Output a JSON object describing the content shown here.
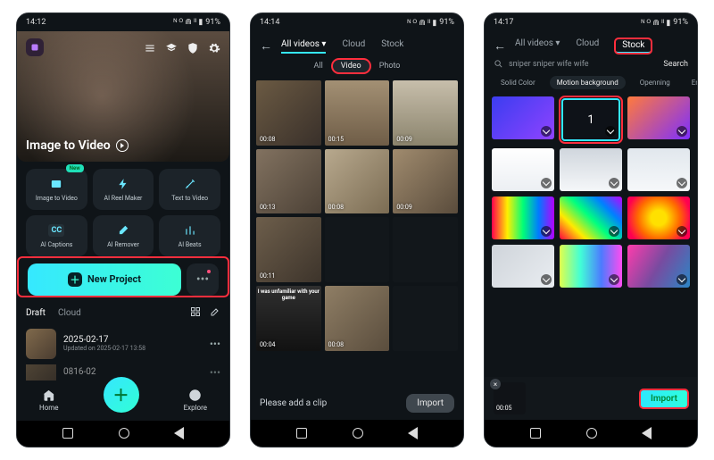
{
  "phone1": {
    "status": {
      "time": "14:12",
      "battery": "91%"
    },
    "hero_title": "Image to Video",
    "tiles": [
      {
        "label": "Image to Video",
        "icon": "film-icon",
        "new": true
      },
      {
        "label": "AI Reel Maker",
        "icon": "bolt-icon"
      },
      {
        "label": "Text to Video",
        "icon": "wand-icon"
      },
      {
        "label": "AI Captions",
        "icon": "cc-icon"
      },
      {
        "label": "AI Remover",
        "icon": "eraser-icon"
      },
      {
        "label": "AI Beats",
        "icon": "equalizer-icon"
      }
    ],
    "new_project": "New Project",
    "draft_tabs": {
      "draft": "Draft",
      "cloud": "Cloud"
    },
    "projects": [
      {
        "name": "2025-02-17",
        "sub": "Updated on 2025-02-17 13:58"
      },
      {
        "name": "0816-02",
        "sub": ""
      }
    ],
    "bottom_nav": {
      "home": "Home",
      "explore": "Explore"
    }
  },
  "phone2": {
    "status": {
      "time": "14:14",
      "battery": "91%"
    },
    "top_tabs": {
      "all_videos": "All videos",
      "cloud": "Cloud",
      "stock": "Stock"
    },
    "sub_tabs": {
      "all": "All",
      "video": "Video",
      "photo": "Photo"
    },
    "clips": [
      {
        "dur": "00:08",
        "bg": "linear-gradient(135deg,#6b5a43,#39302a)"
      },
      {
        "dur": "00:15",
        "bg": "linear-gradient(180deg,#a39074,#6f5d47)"
      },
      {
        "dur": "00:09",
        "bg": "linear-gradient(180deg,#c7beab,#8b846d)"
      },
      {
        "dur": "00:13",
        "bg": "linear-gradient(135deg,#827260,#4c4136)"
      },
      {
        "dur": "00:08",
        "bg": "linear-gradient(135deg,#b8a98e,#7b6c53)"
      },
      {
        "dur": "00:09",
        "bg": "linear-gradient(135deg,#a08b6e,#5a4c3c)"
      },
      {
        "dur": "00:11",
        "bg": "linear-gradient(135deg,#6d5e4b,#3d342b)"
      },
      {
        "dur": "",
        "bg": "#12171b"
      },
      {
        "dur": "",
        "bg": "#12171b"
      },
      {
        "dur": "00:04",
        "bg": "linear-gradient(180deg,#2f2f2f,#121212)",
        "meme": "I was unfamiliar with your game"
      },
      {
        "dur": "00:08",
        "bg": "linear-gradient(135deg,#8f7e65,#5a4d3d)"
      },
      {
        "dur": "",
        "bg": "#12171b"
      }
    ],
    "hint": "Please add a clip",
    "import": "Import"
  },
  "phone3": {
    "status": {
      "time": "14:17",
      "battery": "91%"
    },
    "top_tabs": {
      "all_videos": "All videos",
      "cloud": "Cloud",
      "stock": "Stock"
    },
    "search": {
      "query": "sniper sniper wife wife",
      "button": "Search"
    },
    "chips": [
      "Solid Color",
      "Motion background",
      "Openning",
      "Ending"
    ],
    "stocks": [
      {
        "bg": "linear-gradient(135deg,#3b3df0,#8f43ff)"
      },
      {
        "bg": "#0e1218",
        "selected": true,
        "count": "1"
      },
      {
        "bg": "linear-gradient(135deg,#ff7a3c,#7d2fff)"
      },
      {
        "bg": "linear-gradient(180deg,#fff,#eceff3)"
      },
      {
        "bg": "linear-gradient(180deg,#d0d6dd,#f5f7f9)"
      },
      {
        "bg": "linear-gradient(180deg,#e1e7ed,#f6f8fa)"
      },
      {
        "bg": "linear-gradient(90deg,#ff004c,#ffef00,#00ff77,#007bff,#b400ff)"
      },
      {
        "bg": "linear-gradient(45deg,#ff0040,#ffea00,#00ff80,#0080ff,#c000ff)"
      },
      {
        "bg": "radial-gradient(circle,#ffe000 20%,#ff6a00 55%,#ff0050 85%)"
      },
      {
        "bg": "linear-gradient(135deg,#cfd4da,#e9edf1)"
      },
      {
        "bg": "linear-gradient(90deg,#e0ff4c,#42ffd6,#4c7bff,#ff4cf0)"
      },
      {
        "bg": "linear-gradient(120deg,#ff3cac,#784ba0,#2b86c5)"
      }
    ],
    "tray_duration": "00:05",
    "import": "Import"
  }
}
